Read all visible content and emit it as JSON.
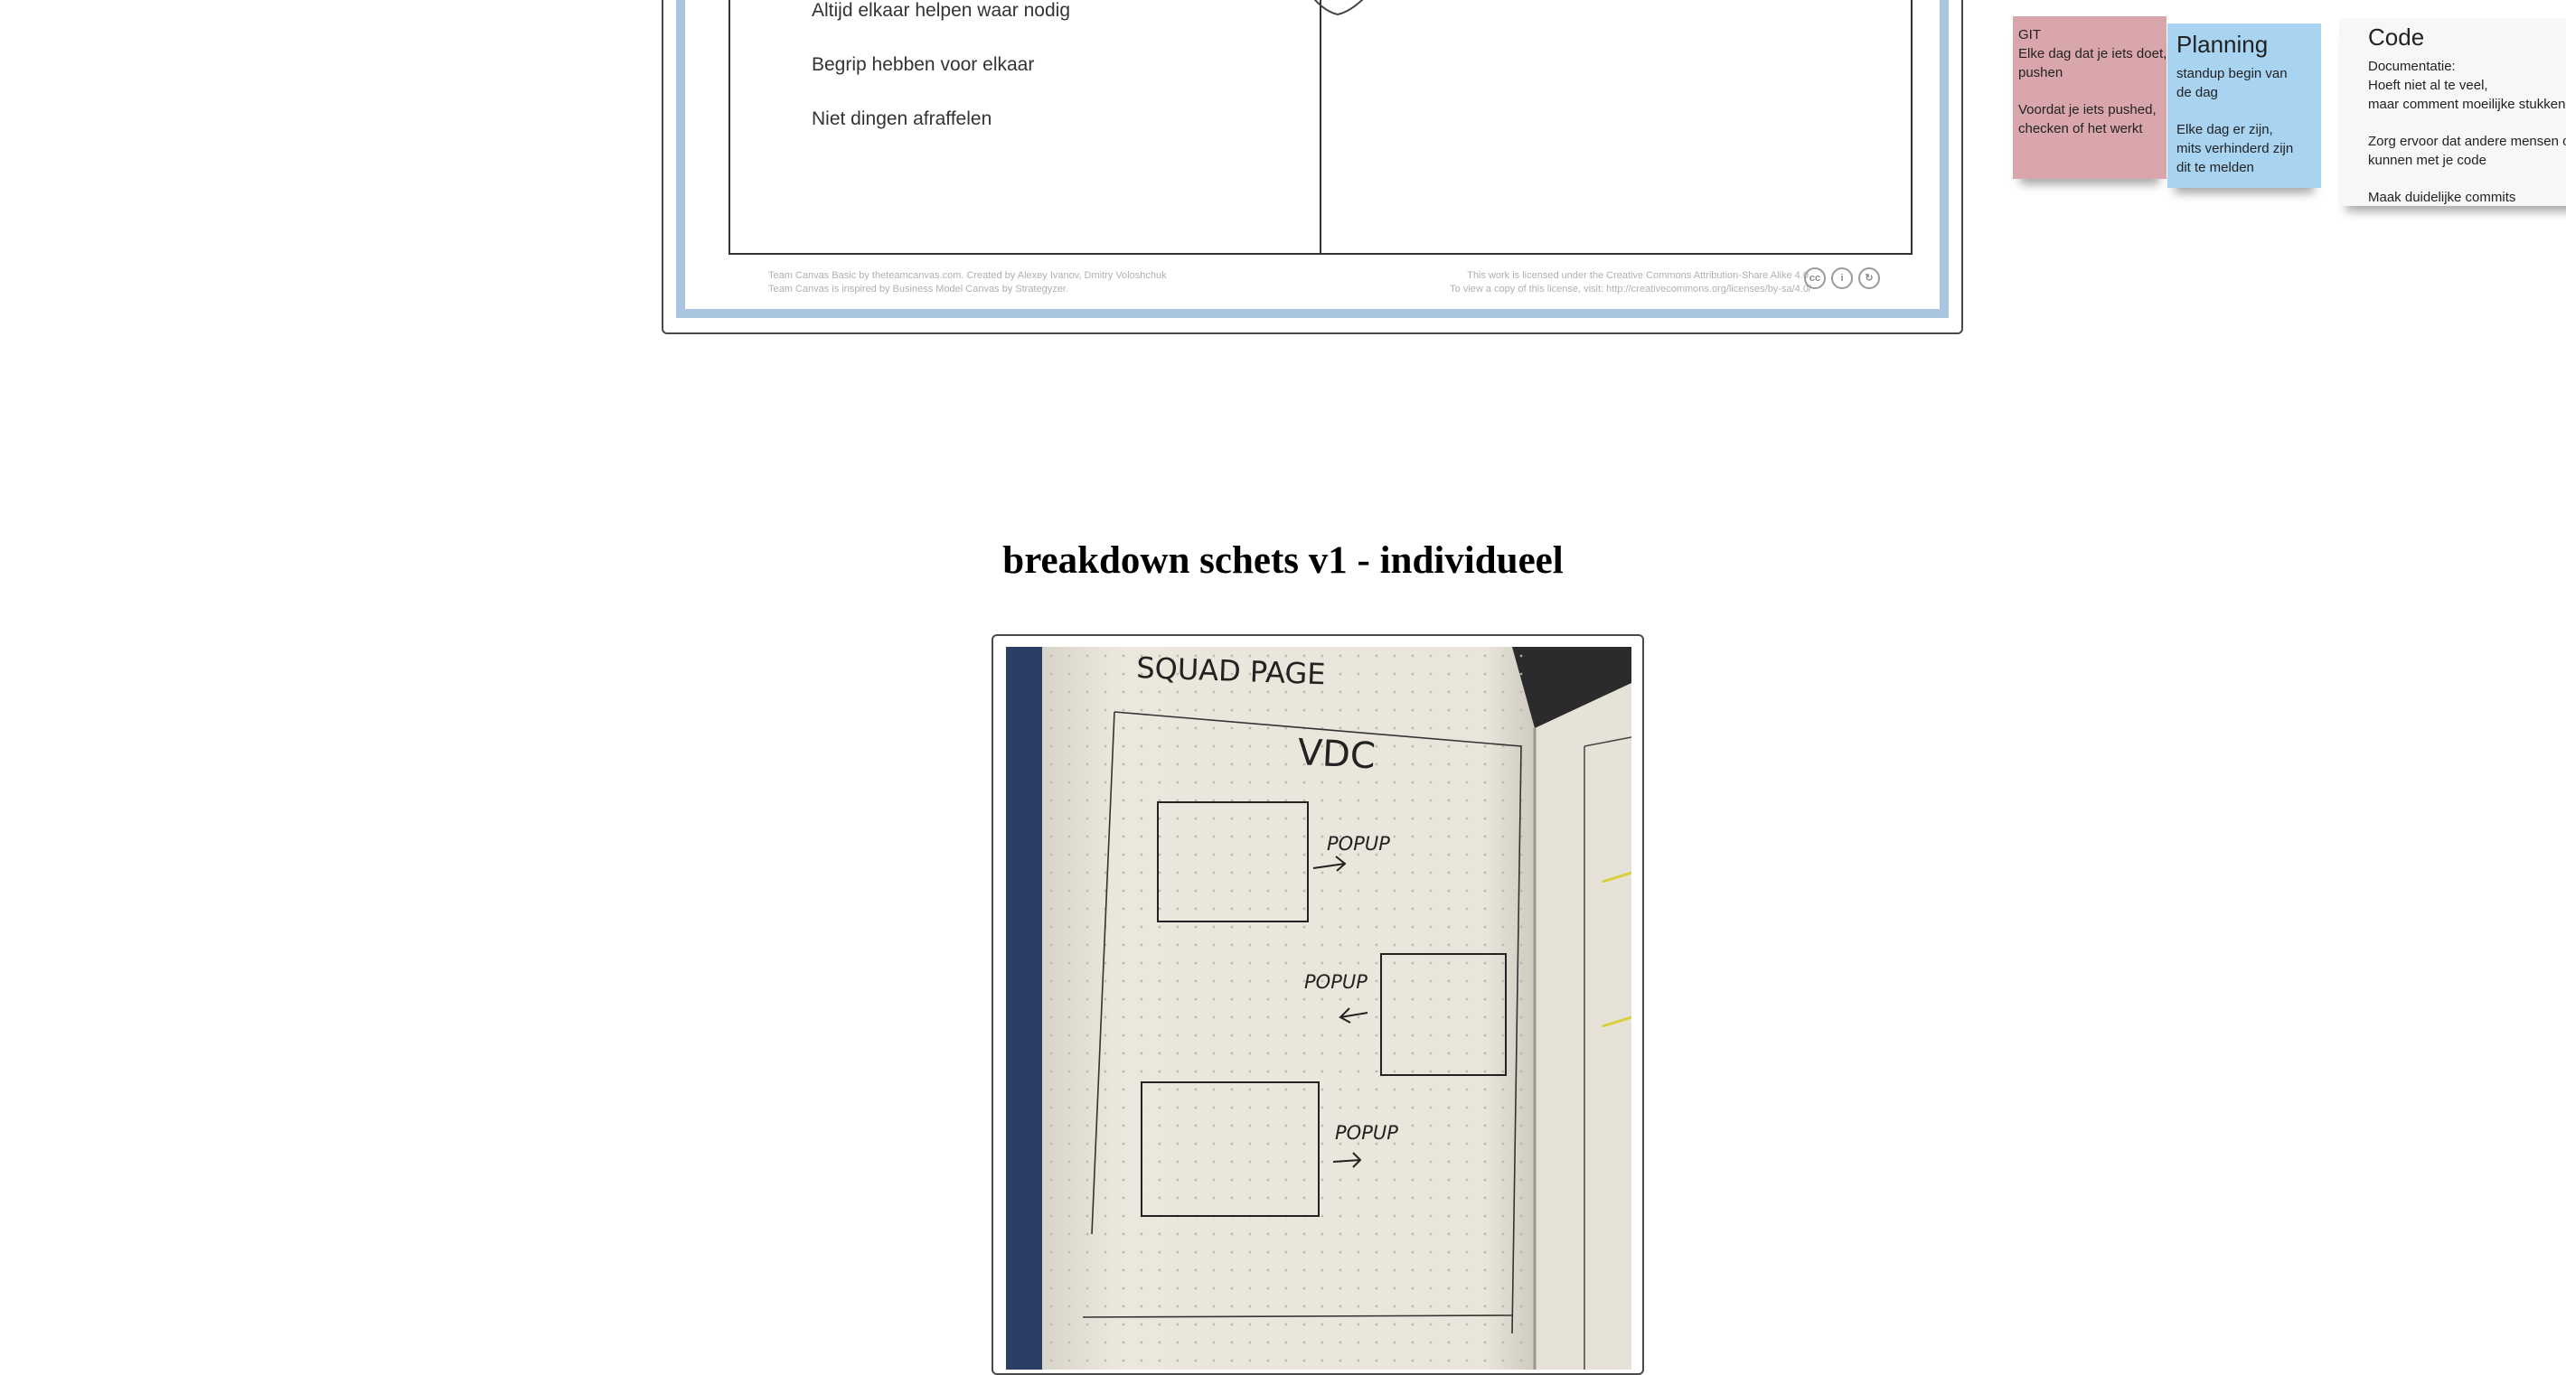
{
  "team_canvas": {
    "rules": [
      "Altijd elkaar helpen waar nodig",
      "Begrip hebben voor elkaar",
      "Niet dingen afraffelen"
    ],
    "sticky_git": {
      "lines": [
        "GIT",
        "Elke dag dat je iets doet,",
        "pushen",
        "",
        "Voordat je iets pushed,",
        "checken of het werkt"
      ]
    },
    "sticky_planning": {
      "title": "Planning",
      "lines": [
        "standup begin van",
        "de dag",
        "",
        "Elke dag er zijn,",
        "mits verhinderd zijn",
        "dit te melden"
      ]
    },
    "sticky_code": {
      "title": "Code",
      "lines": [
        "Documentatie:",
        "Hoeft niet al te veel,",
        "maar comment moeilijke stukken code",
        "",
        "Zorg ervoor dat andere mensen overweg",
        "kunnen met je code",
        "",
        "Maak duidelijke commits"
      ]
    },
    "footer_left": [
      "Team Canvas Basic by theteamcanvas.com. Created by Alexey Ivanov, Dmitry Voloshchuk",
      "Team Canvas is inspired by Business Model Canvas by Strategyzer."
    ],
    "footer_right": [
      "This work is licensed under the Creative Commons Attribution-Share Alike 4.0.",
      "To view a copy of this license, visit: http://creativecommons.org/licenses/by-sa/4.0/"
    ],
    "license_icons": [
      "cc-icon",
      "attribution-icon",
      "share-alike-icon"
    ]
  },
  "section": {
    "heading": "breakdown schets v1 - individueel"
  },
  "sketch": {
    "title": "SQUAD PAGE",
    "subtitle": "VDC",
    "labels": [
      "POPUP",
      "POPUP",
      "POPUP"
    ]
  },
  "colors": {
    "canvas_frame": "#a9c4df",
    "sticky_git": "#d9a6ac",
    "sticky_planning": "#a8d3f1",
    "sticky_code": "#f7f7f7"
  }
}
